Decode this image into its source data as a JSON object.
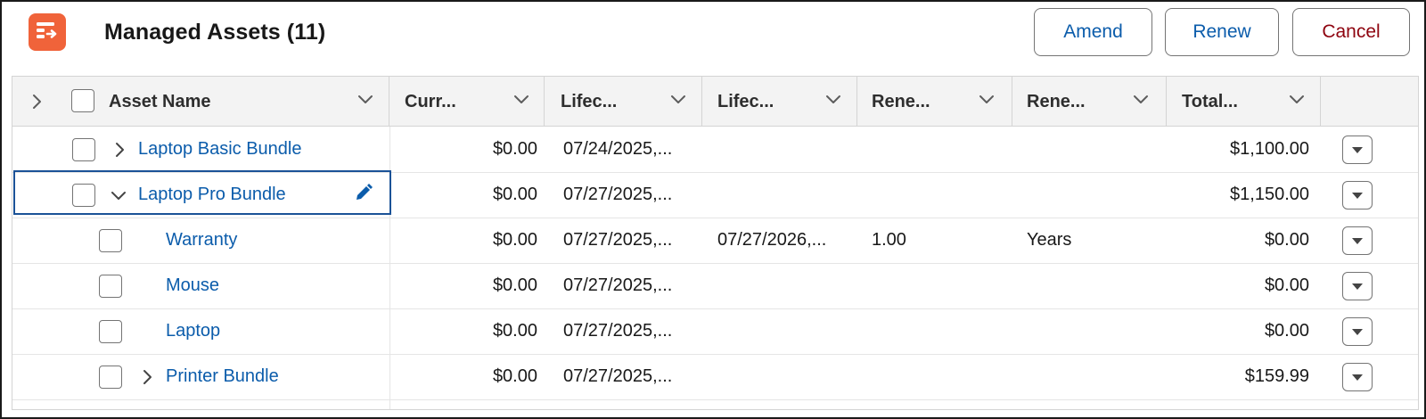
{
  "header": {
    "title": "Managed Assets (11)",
    "app_icon": "related-list-icon",
    "buttons": {
      "amend": "Amend",
      "renew": "Renew",
      "cancel": "Cancel"
    }
  },
  "colors": {
    "brand_icon": "#f0633a",
    "link": "#0b5cab",
    "cancel_text": "#8e030f",
    "selection_border": "#1b5297"
  },
  "table": {
    "columns": [
      {
        "label": "Asset Name"
      },
      {
        "label": "Curr..."
      },
      {
        "label": "Lifec..."
      },
      {
        "label": "Lifec..."
      },
      {
        "label": "Rene..."
      },
      {
        "label": "Rene..."
      },
      {
        "label": "Total..."
      }
    ],
    "rows": [
      {
        "name": "Laptop Basic Bundle",
        "expander": "collapsed",
        "current": "$0.00",
        "lifecycle_start": "07/24/2025,...",
        "lifecycle_end": "",
        "renewal_term": "",
        "renewal_unit": "",
        "total": "$1,100.00"
      },
      {
        "name": "Laptop Pro Bundle",
        "expander": "expanded",
        "current": "$0.00",
        "lifecycle_start": "07/27/2025,...",
        "lifecycle_end": "",
        "renewal_term": "",
        "renewal_unit": "",
        "total": "$1,150.00"
      },
      {
        "name": "Warranty",
        "expander": "none",
        "current": "$0.00",
        "lifecycle_start": "07/27/2025,...",
        "lifecycle_end": "07/27/2026,...",
        "renewal_term": "1.00",
        "renewal_unit": "Years",
        "total": "$0.00"
      },
      {
        "name": "Mouse",
        "expander": "none",
        "current": "$0.00",
        "lifecycle_start": "07/27/2025,...",
        "lifecycle_end": "",
        "renewal_term": "",
        "renewal_unit": "",
        "total": "$0.00"
      },
      {
        "name": "Laptop",
        "expander": "none",
        "current": "$0.00",
        "lifecycle_start": "07/27/2025,...",
        "lifecycle_end": "",
        "renewal_term": "",
        "renewal_unit": "",
        "total": "$0.00"
      },
      {
        "name": "Printer Bundle",
        "expander": "collapsed",
        "current": "$0.00",
        "lifecycle_start": "07/27/2025,...",
        "lifecycle_end": "",
        "renewal_term": "",
        "renewal_unit": "",
        "total": "$159.99"
      }
    ]
  }
}
